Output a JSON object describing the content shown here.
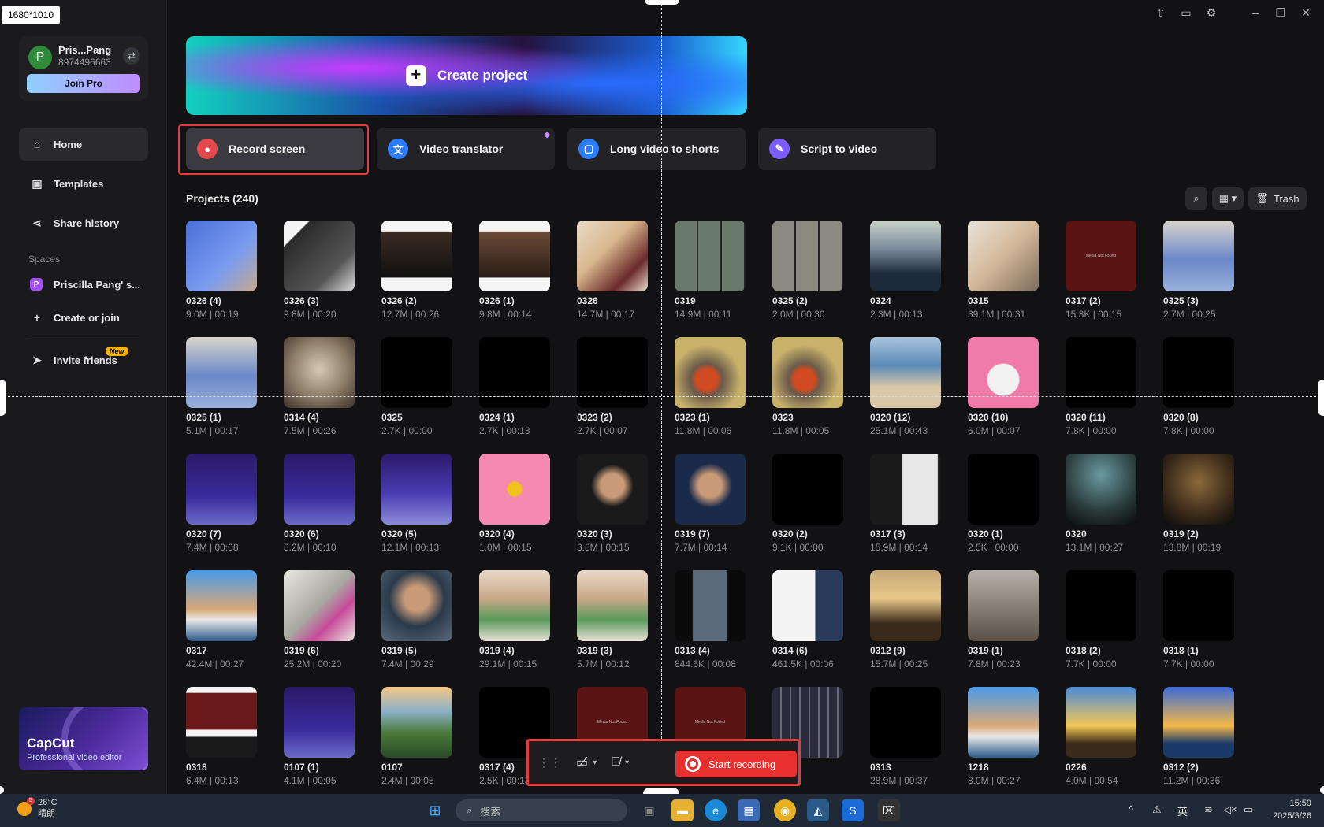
{
  "dimension_tag": "1680*1010",
  "user": {
    "initial": "P",
    "name": "Pris...Pang",
    "id": "8974496663",
    "join_pro": "Join Pro"
  },
  "nav": {
    "home": "Home",
    "templates": "Templates",
    "share_history": "Share history",
    "spaces_label": "Spaces",
    "space_name": "Priscilla Pang' s...",
    "space_initial": "P",
    "create_or_join": "Create or join",
    "invite_friends": "Invite friends",
    "new_badge": "New"
  },
  "promo": {
    "title": "CapCut",
    "subtitle": "Professional video editor"
  },
  "create_project": "Create project",
  "tools": [
    {
      "label": "Record screen",
      "color": "#e5484d"
    },
    {
      "label": "Video translator",
      "color": "#2b7cff"
    },
    {
      "label": "Long video to shorts",
      "color": "#2b7cff"
    },
    {
      "label": "Script to video",
      "color": "#7a5cff"
    }
  ],
  "projects_header": "Projects  (240)",
  "trash": "Trash",
  "projects": [
    {
      "name": "0326 (4)",
      "meta": "9.0M | 00:19",
      "bg": "linear-gradient(135deg,#4a6fd8,#7a9cf0 60%,#c9a98a)"
    },
    {
      "name": "0326 (3)",
      "meta": "9.8M | 00:20",
      "bg": "linear-gradient(135deg,#f4f4f4 0%,#f4f4f4 18%,#2b2b2b 19%,#555 70%,#ddd)"
    },
    {
      "name": "0326 (2)",
      "meta": "12.7M | 00:26",
      "bg": "linear-gradient(180deg,#f5f5f5 0%,#f5f5f5 15%,#3a2b22 16%,#111 80%,#f5f5f5 81%)"
    },
    {
      "name": "0326 (1)",
      "meta": "9.8M | 00:14",
      "bg": "linear-gradient(180deg,#f5f5f5 0%,#f5f5f5 15%,#6b4a36 16%,#2a1d17 80%,#f5f5f5 81%)"
    },
    {
      "name": "0326",
      "meta": "14.7M | 00:17",
      "bg": "linear-gradient(135deg,#e9dcc8,#d9b890 40%,#6b2a2a 75%,#e9dcc8)"
    },
    {
      "name": "0319",
      "meta": "14.9M | 00:11",
      "bg": "repeating-linear-gradient(90deg,#6a7a6a 0 28px,#222 28px 30px)"
    },
    {
      "name": "0325 (2)",
      "meta": "2.0M | 00:30",
      "bg": "repeating-linear-gradient(90deg,#8a8a80 0 28px,#222 28px 30px)"
    },
    {
      "name": "0324",
      "meta": "2.3M | 00:13",
      "bg": "linear-gradient(180deg,#c9d3c8,#7a8a9a 40%,#1d2a3a 75%)"
    },
    {
      "name": "0315",
      "meta": "39.1M | 00:31",
      "bg": "linear-gradient(135deg,#e8e4da,#d4b89a 50%,#7b6b5b)"
    },
    {
      "name": "0317 (2)",
      "meta": "15.3K | 00:15",
      "bg": "#5a1414",
      "mnf": "Media Not Found"
    },
    {
      "name": "0325 (3)",
      "meta": "2.7M | 00:25",
      "bg": "linear-gradient(180deg,#d8d4cc,#6a88c8 55%,#9ab0dc)"
    },
    {
      "name": "0325 (1)",
      "meta": "5.1M | 00:17",
      "bg": "linear-gradient(180deg,#d8d4cc,#6a88c8 55%,#9ab0dc)"
    },
    {
      "name": "0314 (4)",
      "meta": "7.5M | 00:26",
      "bg": "radial-gradient(circle at 50% 45%,#d6c9b4,#8a7a66 55%,#3a3128)"
    },
    {
      "name": "0325",
      "meta": "2.7K | 00:00",
      "bg": "#000"
    },
    {
      "name": "0324 (1)",
      "meta": "2.7K | 00:13",
      "bg": "#000"
    },
    {
      "name": "0323 (2)",
      "meta": "2.7K | 00:07",
      "bg": "#000"
    },
    {
      "name": "0323 (1)",
      "meta": "11.8M | 00:06",
      "bg": "radial-gradient(circle at 45% 60%,#d04a22 0 18%,#6a5a4a 28%,#c8b26a 60%)"
    },
    {
      "name": "0323",
      "meta": "11.8M | 00:05",
      "bg": "radial-gradient(circle at 45% 60%,#d04a22 0 18%,#6a5a4a 28%,#c8b26a 60%)"
    },
    {
      "name": "0320 (12)",
      "meta": "25.1M | 00:43",
      "bg": "linear-gradient(180deg,#a8c4dc,#5a8ab8 40%,#d8c8a8 70%)"
    },
    {
      "name": "0320 (10)",
      "meta": "6.0M | 00:07",
      "bg": "radial-gradient(circle at 50% 60%,#f2f2f2 0 28%,#f07aa8 30%)"
    },
    {
      "name": "0320 (11)",
      "meta": "7.8K | 00:00",
      "bg": "#000"
    },
    {
      "name": "0320 (8)",
      "meta": "7.8K | 00:00",
      "bg": "#000"
    },
    {
      "name": "0320 (7)",
      "meta": "7.4M | 00:08",
      "bg": "linear-gradient(180deg,#2a1a6a,#3a2a9a 60%,#6a6ac8)"
    },
    {
      "name": "0320 (6)",
      "meta": "8.2M | 00:10",
      "bg": "linear-gradient(180deg,#2a1a6a,#3a2a9a 60%,#6a6ac8)"
    },
    {
      "name": "0320 (5)",
      "meta": "12.1M | 00:13",
      "bg": "linear-gradient(180deg,#2a1a6a,#4a3ab0 55%,#8a8ad8)"
    },
    {
      "name": "0320 (4)",
      "meta": "1.0M | 00:15",
      "bg": "radial-gradient(circle at 50% 50%,#f2c21a 0 14%,#f48ab0 16%)"
    },
    {
      "name": "0320 (3)",
      "meta": "3.8M | 00:15",
      "bg": "radial-gradient(circle at 50% 45%,#c89a78 0 22%,#1a1a1a 40%)"
    },
    {
      "name": "0319 (7)",
      "meta": "7.7M | 00:14",
      "bg": "radial-gradient(circle at 50% 45%,#c89a78 0 22%,#1a2a4a 42%)"
    },
    {
      "name": "0320 (2)",
      "meta": "9.1K | 00:00",
      "bg": "#000"
    },
    {
      "name": "0317 (3)",
      "meta": "15.9M | 00:14",
      "bg": "linear-gradient(90deg,#1a1a1a 0 45%,#e8e8e8 46% 95%,#1a1a1a 96%)"
    },
    {
      "name": "0320 (1)",
      "meta": "2.5K | 00:00",
      "bg": "#000"
    },
    {
      "name": "0320",
      "meta": "13.1M | 00:27",
      "bg": "radial-gradient(circle at 50% 30%,#6a9aa0,#2a3a3a 60%,#0a0a0a)"
    },
    {
      "name": "0319 (2)",
      "meta": "13.8M | 00:19",
      "bg": "radial-gradient(circle at 50% 40%,#8a6a3a,#3a2a1a 60%,#0a0a0a)"
    },
    {
      "name": "0317",
      "meta": "42.4M | 00:27",
      "bg": "linear-gradient(180deg,#4a9ae8,#d8a878 55%,#e8e8e8 70%,#2a5a8a)"
    },
    {
      "name": "0319 (6)",
      "meta": "25.2M | 00:20",
      "bg": "linear-gradient(135deg,#e8e8e0,#a8a8a0 50%,#c84a9a 70%,#e8e8e0)"
    },
    {
      "name": "0319 (5)",
      "meta": "7.4M | 00:29",
      "bg": "radial-gradient(circle at 50% 40%,#c89a78 0 22%,#2a3a4a 50%,#5a6a7a)"
    },
    {
      "name": "0319 (4)",
      "meta": "29.1M | 00:15",
      "bg": "linear-gradient(180deg,#e8d8c8,#c8a888 40%,#5a9a5a 70%,#e8e0d8)"
    },
    {
      "name": "0319 (3)",
      "meta": "5.7M | 00:12",
      "bg": "linear-gradient(180deg,#e8d8c8,#c8a888 40%,#5a9a5a 70%,#e8e0d8)"
    },
    {
      "name": "0313 (4)",
      "meta": "844.6K | 00:08",
      "bg": "linear-gradient(90deg,#0a0a0a 0 25%,#5a6a7a 26% 74%,#0a0a0a 75%)"
    },
    {
      "name": "0314 (6)",
      "meta": "461.5K | 00:06",
      "bg": "linear-gradient(90deg,#f4f4f4 0 60%,#2a3a5a 61%)"
    },
    {
      "name": "0312 (9)",
      "meta": "15.7M | 00:25",
      "bg": "linear-gradient(180deg,#c8a878,#e8c888 40%,#3a2a1a 75%)"
    },
    {
      "name": "0319 (1)",
      "meta": "7.8M | 00:23",
      "bg": "linear-gradient(180deg,#b8b0a8,#8a8078 50%,#5a5048)"
    },
    {
      "name": "0318 (2)",
      "meta": "7.7K | 00:00",
      "bg": "#000"
    },
    {
      "name": "0318 (1)",
      "meta": "7.7K | 00:00",
      "bg": "#000"
    },
    {
      "name": "0318",
      "meta": "6.4M | 00:13",
      "bg": "linear-gradient(180deg,#f4f4f4 0 8%,#6a1a1a 9% 60%,#f4f4f4 61% 70%,#1a1a1a 71%)"
    },
    {
      "name": "0107 (1)",
      "meta": "4.1M | 00:05",
      "bg": "linear-gradient(180deg,#2a1a6a,#3a2a9a 60%,#6a6ac8)"
    },
    {
      "name": "0107",
      "meta": "2.4M | 00:05",
      "bg": "linear-gradient(180deg,#f4c888,#8ab0c8 35%,#4a7a3a 65%,#2a4a2a)"
    },
    {
      "name": "0317 (4)",
      "meta": "2.5K | 00:13",
      "bg": "#000"
    },
    {
      "name": "",
      "meta": "",
      "bg": "#5a1414",
      "mnf": "Media Not Found"
    },
    {
      "name": "",
      "meta": "",
      "bg": "#5a1414",
      "mnf": "Media Not Found"
    },
    {
      "name": "",
      "meta": "00:12",
      "bg": "repeating-linear-gradient(90deg,#2a2a3a 0 10px,#6a6a7a 10px 12px)"
    },
    {
      "name": "0313",
      "meta": "28.9M | 00:37",
      "bg": "#000"
    },
    {
      "name": "1218",
      "meta": "8.0M | 00:27",
      "bg": "linear-gradient(180deg,#4a9ae8,#d8a878 55%,#e8e8e8 70%,#2a5a8a)"
    },
    {
      "name": "0226",
      "meta": "4.0M | 00:54",
      "bg": "linear-gradient(180deg,#4a8ad8,#f4c858 55%,#3a2a1a 80%)"
    },
    {
      "name": "0312 (2)",
      "meta": "11.2M | 00:36",
      "bg": "linear-gradient(180deg,#3a6ad8,#f4b848 55%,#1a3a6a 80%)"
    }
  ],
  "recorder": {
    "start_label": "Start recording"
  },
  "taskbar": {
    "temp": "26°C",
    "weather": "晴朗",
    "weather_badge": "5",
    "search_placeholder": "搜索",
    "ime": "英",
    "time": "15:59",
    "date": "2025/3/26"
  }
}
